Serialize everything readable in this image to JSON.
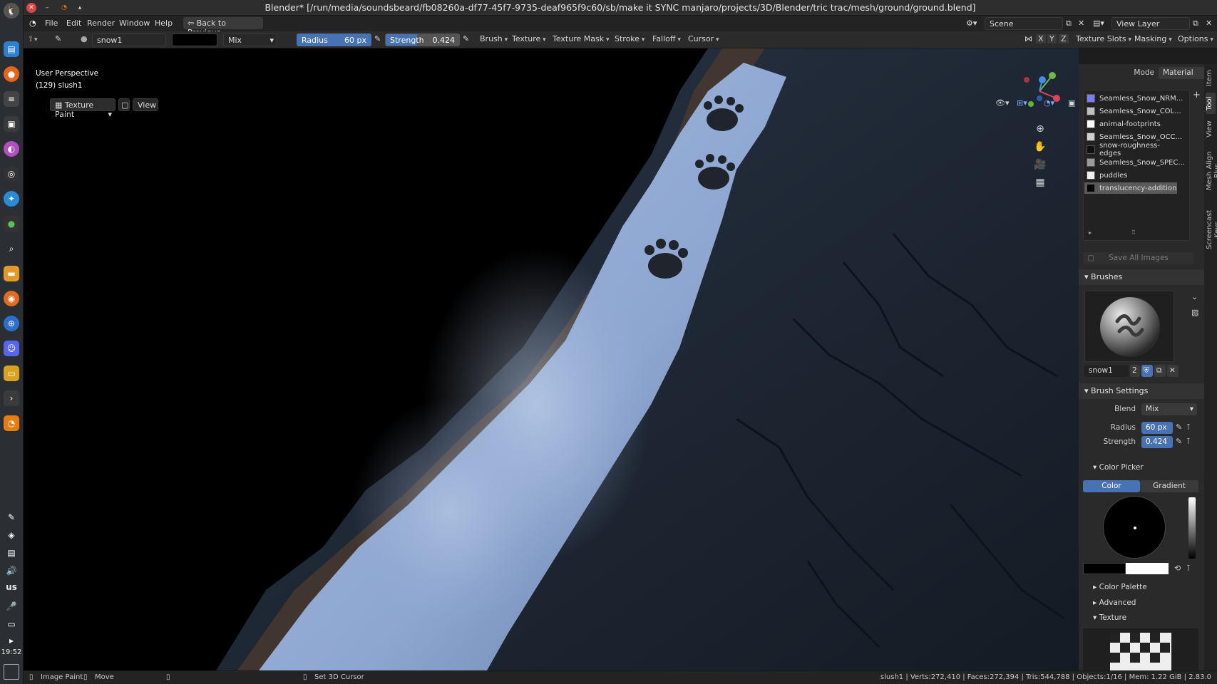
{
  "window": {
    "title": "Blender* [/run/media/soundsbeard/fb08260a-df77-45f7-9735-deaf965f9c60/sb/make it SYNC manjaro/projects/3D/Blender/tric trac/mesh/ground/ground.blend]"
  },
  "dock": {
    "language": "us",
    "clock": "19:52"
  },
  "menubar": {
    "items": [
      "File",
      "Edit",
      "Render",
      "Window",
      "Help"
    ],
    "back_button": "Back to Previous",
    "scene_label": "Scene",
    "view_layer_label": "View Layer"
  },
  "toolheader": {
    "brush_name": "snow1",
    "blend_mode": "Mix",
    "radius_label": "Radius",
    "radius_value": "60 px",
    "strength_label": "Strength",
    "strength_value": "0.424",
    "strength_fraction": 0.424,
    "menus": [
      "Brush",
      "Texture",
      "Texture Mask",
      "Stroke",
      "Falloff",
      "Cursor"
    ],
    "axes": [
      "X",
      "Y",
      "Z"
    ],
    "texture_slots": "Texture Slots",
    "masking": "Masking",
    "options": "Options"
  },
  "viewheader": {
    "mode": "Texture Paint",
    "view": "View"
  },
  "viewport": {
    "perspective": "User Perspective",
    "object": "(129) slush1"
  },
  "npanel": {
    "mode_label": "Mode",
    "mode_value": "Material",
    "slots": [
      {
        "name": "Seamless_Snow_NRM...",
        "color": "#7b7bff"
      },
      {
        "name": "Seamless_Snow_COL...",
        "color": "#bfbfbf"
      },
      {
        "name": "animal-footprints",
        "color": "#ffffff"
      },
      {
        "name": "Seamless_Snow_OCC...",
        "color": "#d0d0d0"
      },
      {
        "name": "snow-roughness-edges",
        "color": "#101010"
      },
      {
        "name": "Seamless_Snow_SPEC...",
        "color": "#9a9a9a"
      },
      {
        "name": "puddles",
        "color": "#f0f0f0"
      },
      {
        "name": "translucency-addition",
        "color": "#050505"
      }
    ],
    "save_all": "Save All Images",
    "brushes_header": "Brushes",
    "brush_name": "snow1",
    "brush_users": "2",
    "brush_settings_header": "Brush Settings",
    "blend_label": "Blend",
    "blend_value": "Mix",
    "radius_label": "Radius",
    "radius_value": "60 px",
    "strength_label": "Strength",
    "strength_value": "0.424",
    "color_picker_header": "Color Picker",
    "color_tab": "Color",
    "gradient_tab": "Gradient",
    "color_palette": "Color Palette",
    "advanced": "Advanced",
    "texture": "Texture",
    "tabs": [
      "Item",
      "Tool",
      "View",
      "Mesh Align Plus",
      "Screencast Keys"
    ]
  },
  "statusbar": {
    "left": [
      "Image Paint",
      "Move",
      "Set 3D Cursor"
    ],
    "right": "slush1 | Verts:272,410 | Faces:272,394 | Tris:544,788 | Objects:1/16 | Mem: 1.22 GiB | 2.83.0"
  }
}
